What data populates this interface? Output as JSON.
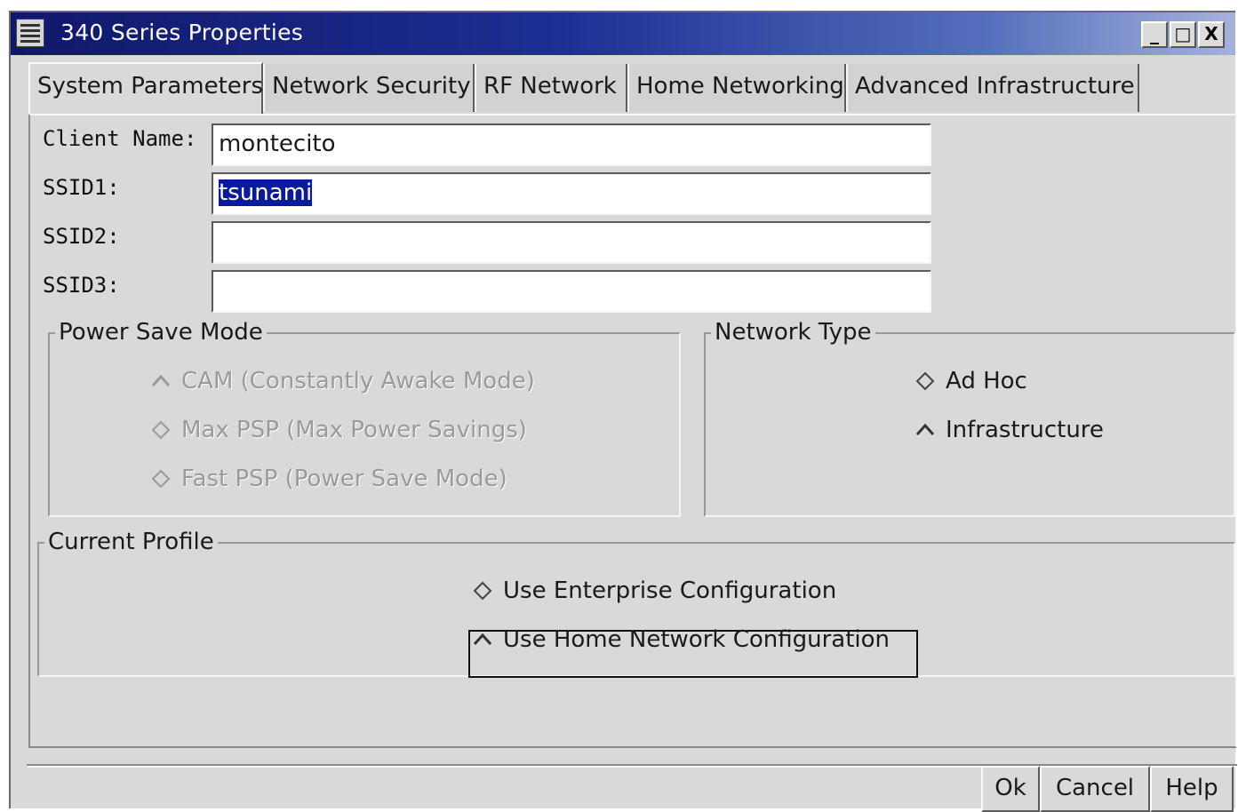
{
  "window": {
    "title": "340 Series Properties",
    "controls": {
      "minimize": "_",
      "maximize": "□",
      "close": "X"
    }
  },
  "tabs": [
    {
      "label": "System Parameters",
      "active": true
    },
    {
      "label": "Network Security",
      "active": false
    },
    {
      "label": "RF Network",
      "active": false
    },
    {
      "label": "Home Networking",
      "active": false
    },
    {
      "label": "Advanced Infrastructure",
      "active": false
    }
  ],
  "fields": {
    "client_name": {
      "label": "Client Name:",
      "value": "montecito"
    },
    "ssid1": {
      "label": "SSID1:",
      "value": "tsunami"
    },
    "ssid2": {
      "label": "SSID2:",
      "value": ""
    },
    "ssid3": {
      "label": "SSID3:",
      "value": ""
    }
  },
  "power_save_mode": {
    "title": "Power Save Mode",
    "enabled": false,
    "options": [
      {
        "label": "CAM (Constantly Awake Mode)",
        "selected": true
      },
      {
        "label": "Max PSP (Max Power Savings)",
        "selected": false
      },
      {
        "label": "Fast PSP (Power Save Mode)",
        "selected": false
      }
    ]
  },
  "network_type": {
    "title": "Network Type",
    "options": [
      {
        "label": "Ad Hoc",
        "selected": false
      },
      {
        "label": "Infrastructure",
        "selected": true
      }
    ]
  },
  "current_profile": {
    "title": "Current Profile",
    "options": [
      {
        "label": "Use Enterprise Configuration",
        "selected": false
      },
      {
        "label": "Use Home Network Configuration",
        "selected": true
      }
    ]
  },
  "buttons": {
    "ok": "Ok",
    "cancel": "Cancel",
    "help": "Help"
  },
  "colors": {
    "title_gradient_start": "#10186a",
    "title_gradient_end": "#a4b2da",
    "dialog_background": "#d9d9d9",
    "selection_background": "#0a1a9c"
  }
}
